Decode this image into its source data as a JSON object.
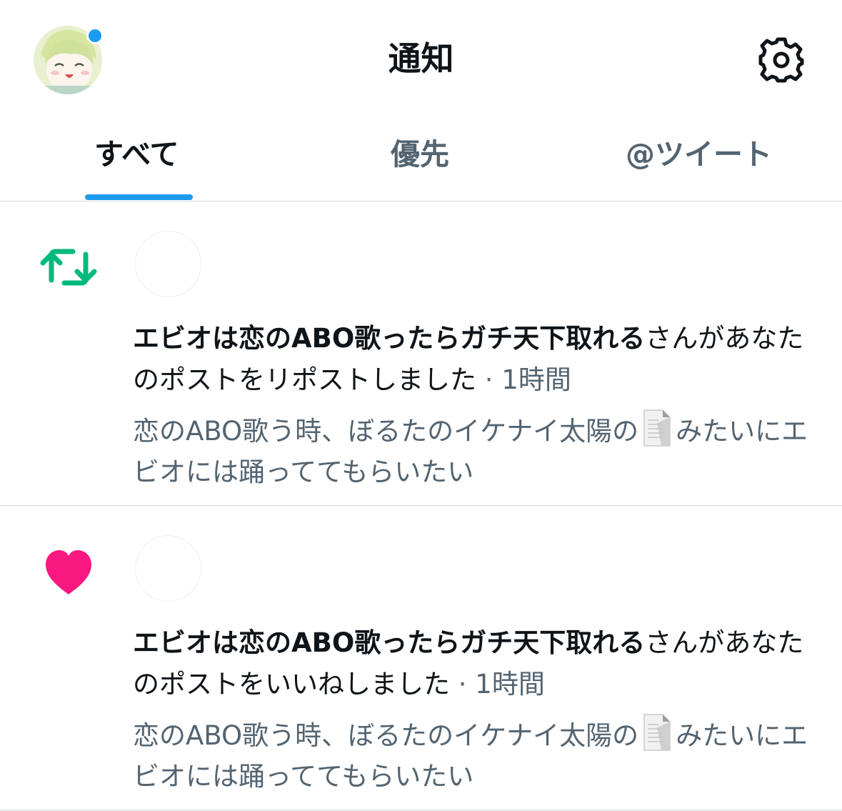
{
  "header": {
    "title": "通知"
  },
  "tabs": [
    {
      "label": "すべて",
      "active": true
    },
    {
      "label": "優先",
      "active": false
    },
    {
      "label": "@ツイート",
      "active": false
    }
  ],
  "notifications": [
    {
      "type": "repost",
      "icon": "repost-icon",
      "icon_color": "#00ba7c",
      "user_name": "エビオは恋のABO歌ったらガチ天下取れる",
      "action_text": "さんがあなたのポストをリポストしました",
      "time": " · 1時間",
      "preview_before": "恋のABO歌う時、ぼるたのイケナイ太陽の",
      "preview_emoji": "page-facing-up-emoji",
      "preview_after": "みたいにエビオには踊っててもらいたい"
    },
    {
      "type": "like",
      "icon": "heart-icon",
      "icon_color": "#f91880",
      "user_name": "エビオは恋のABO歌ったらガチ天下取れる",
      "action_text": "さんがあなたのポストをいいねしました",
      "time": " · 1時間",
      "preview_before": "恋のABO歌う時、ぼるたのイケナイ太陽の",
      "preview_emoji": "page-facing-up-emoji",
      "preview_after": "みたいにエビオには踊っててもらいたい"
    }
  ],
  "colors": {
    "accent": "#1d9bf0",
    "text_primary": "#0f1419",
    "text_secondary": "#536471",
    "divider": "#d7dbdd"
  }
}
